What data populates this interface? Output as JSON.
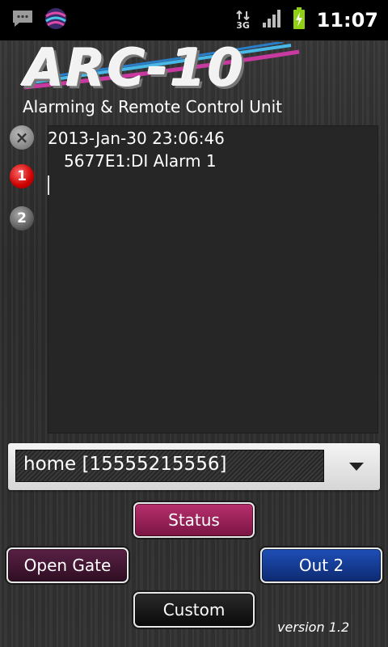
{
  "status_bar": {
    "time": "11:07",
    "network": "3G",
    "icons": [
      "chat-notification-icon",
      "app-sphere-icon",
      "data-transfer-icon",
      "signal-icon",
      "battery-charging-icon"
    ]
  },
  "logo": {
    "title": "ARC-10",
    "subtitle": "Alarming & Remote Control Unit"
  },
  "side_icons": {
    "clear": "×",
    "one": "1",
    "two": "2"
  },
  "log": {
    "line1": "2013-Jan-30 23:06:46",
    "line2": "5677E1:DI Alarm 1"
  },
  "spinner": {
    "selected": "home [15555215556]"
  },
  "buttons": {
    "status": "Status",
    "open_gate": "Open Gate",
    "out2": "Out 2",
    "custom": "Custom"
  },
  "version": "version 1.2",
  "colors": {
    "status_button": "#a8285f",
    "open_gate_button": "#4a1838",
    "out2_button": "#1a44a8",
    "custom_button": "#1a1a1a",
    "alarm_badge": "#d40000"
  }
}
